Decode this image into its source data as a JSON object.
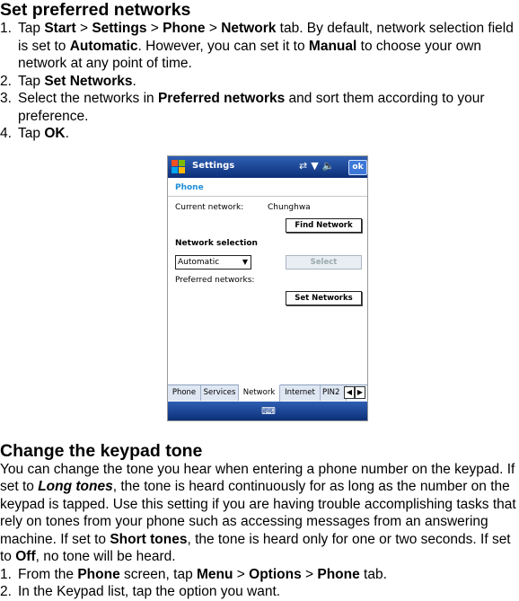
{
  "section1": {
    "title": "Set preferred networks",
    "steps": [
      {
        "num": "1.",
        "parts": [
          "Tap ",
          "Start",
          " > ",
          "Settings",
          " > ",
          "Phone",
          " > ",
          "Network",
          " tab. By default, network selection field is set to ",
          "Automatic",
          ". However, you can set it to ",
          "Manual",
          " to choose your own network at any point of time."
        ]
      },
      {
        "num": "2.",
        "parts": [
          "Tap ",
          "Set Networks",
          "."
        ]
      },
      {
        "num": "3.",
        "parts": [
          "Select the networks in ",
          "Preferred networks",
          " and sort them according to your preference."
        ]
      },
      {
        "num": "4.",
        "parts": [
          "Tap ",
          "OK",
          "."
        ]
      }
    ]
  },
  "screenshot": {
    "title_bar": "Settings",
    "ok_label": "ok",
    "subtitle": "Phone",
    "current_network_label": "Current network:",
    "current_network_value": "Chunghwa",
    "find_network_button": "Find Network",
    "network_selection_label": "Network selection",
    "network_selection_value": "Automatic",
    "select_button": "Select",
    "preferred_networks_label": "Preferred networks:",
    "set_networks_button": "Set Networks",
    "tabs": [
      "Phone",
      "Services",
      "Network",
      "Internet",
      "PIN2"
    ],
    "active_tab": "Network",
    "icons": {
      "start": "windows-flag-icon",
      "signal": "signal-icon",
      "speaker": "speaker-icon",
      "keyboard": "keyboard-icon"
    },
    "colors": {
      "title_bar": "#1a4a9c",
      "accent_blue": "#1f8fd8"
    }
  },
  "section2": {
    "title": "Change the keypad tone",
    "paragraph_parts": [
      "You can change the tone you hear when entering a phone number on the keypad. If set to ",
      "Long tones",
      ", the tone is heard continuously for as long as the number on the keypad is tapped. Use this setting if you are having trouble accomplishing tasks that rely on tones from your phone such as accessing messages from an answering machine. If set to ",
      "Short tones",
      ", the tone is heard only for one or two seconds. If set to ",
      "Off",
      ", no tone will be heard."
    ],
    "steps": [
      {
        "num": "1.",
        "parts": [
          "From the ",
          "Phone",
          " screen, tap ",
          "Menu",
          " > ",
          "Options",
          " > ",
          "Phone",
          " tab."
        ]
      },
      {
        "num": "2.",
        "parts": [
          "In the Keypad list, tap the option you want."
        ]
      }
    ]
  }
}
